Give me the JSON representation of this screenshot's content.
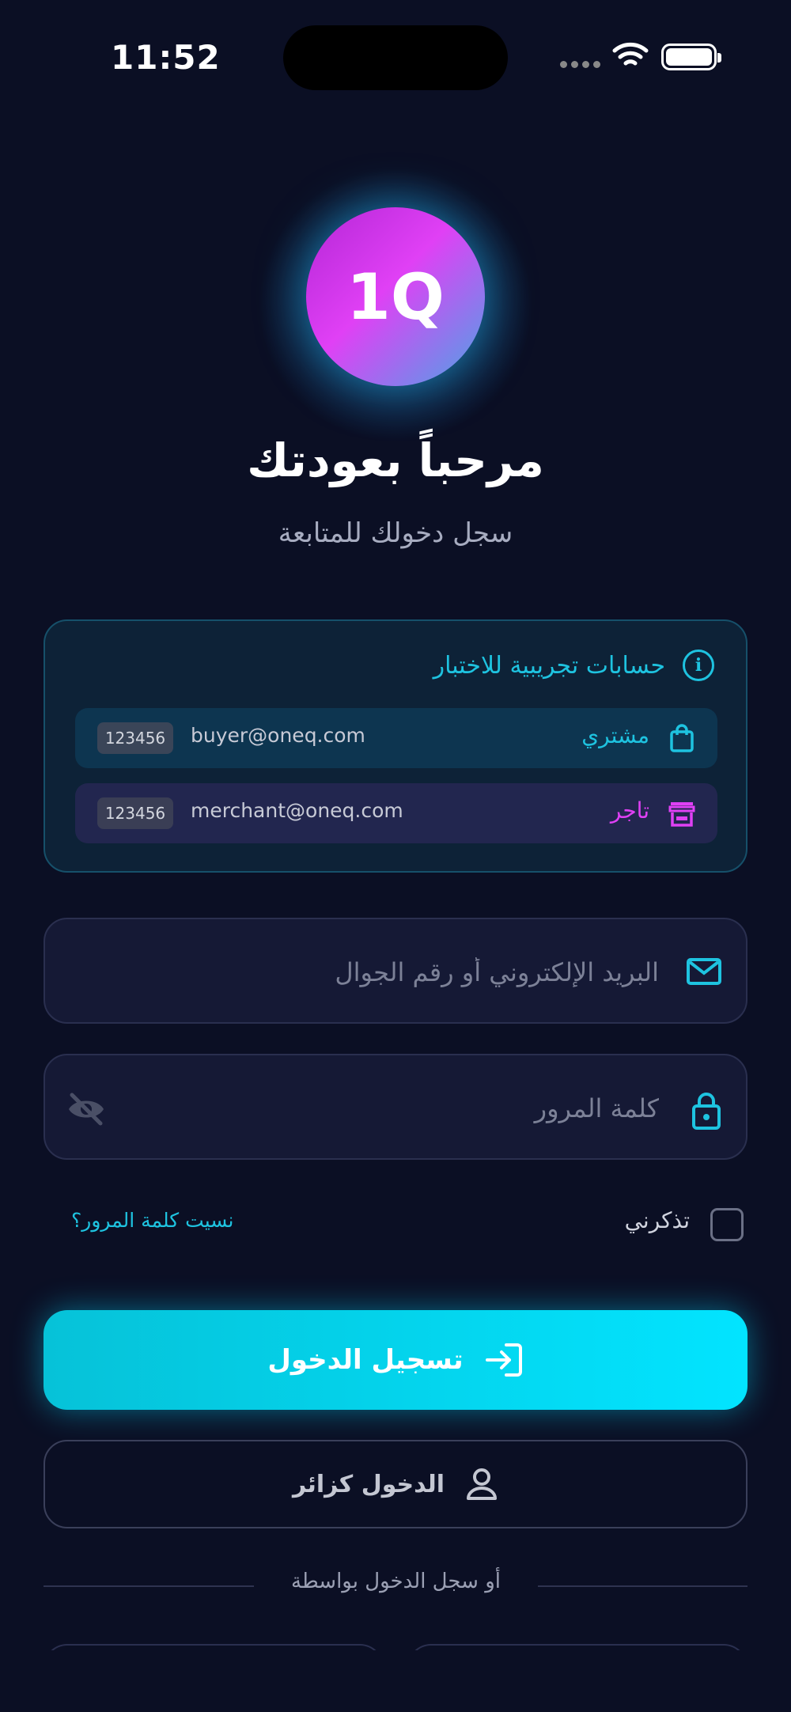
{
  "status_bar": {
    "time": "11:52"
  },
  "logo": {
    "text": "1Q"
  },
  "header": {
    "title": "مرحباً بعودتك",
    "subtitle": "سجل دخولك للمتابعة"
  },
  "demo": {
    "title": "حسابات تجريبية للاختبار",
    "accounts": [
      {
        "role": "مشتري",
        "email": "buyer@oneq.com",
        "password": "123456",
        "icon": "shopping-bag-icon"
      },
      {
        "role": "تاجر",
        "email": "merchant@oneq.com",
        "password": "123456",
        "icon": "store-icon"
      }
    ]
  },
  "form": {
    "email_placeholder": "البريد الإلكتروني أو رقم الجوال",
    "password_placeholder": "كلمة المرور",
    "remember_label": "تذكرني",
    "forgot_label": "نسيت كلمة المرور؟",
    "login_label": "تسجيل الدخول",
    "guest_label": "الدخول كزائر",
    "divider_text": "أو سجل الدخول بواسطة"
  },
  "colors": {
    "background": "#0b0f24",
    "accent": "#1ec3e0",
    "merchant_accent": "#e040f5"
  }
}
